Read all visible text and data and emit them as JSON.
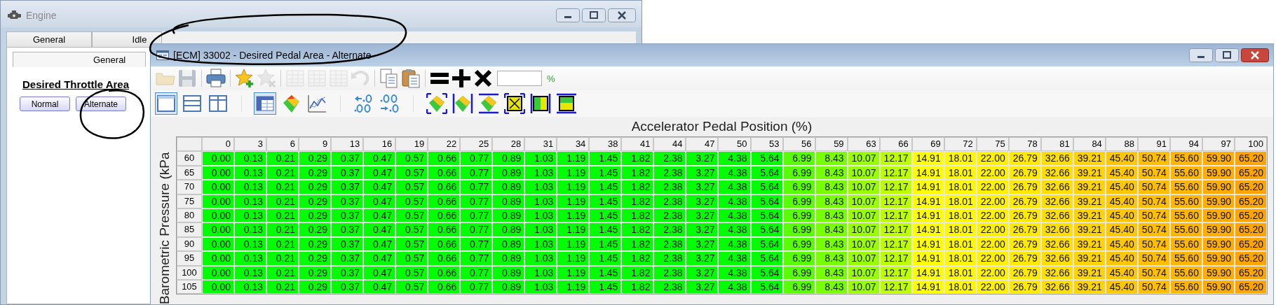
{
  "background_window": {
    "title": "Engine",
    "tabs": [
      {
        "label": "General",
        "selected": false
      },
      {
        "label": "Idle",
        "selected": false
      }
    ],
    "subtabs": [
      {
        "label": "General",
        "selected": true
      }
    ],
    "section_title": "Desired Throttle Area",
    "buttons": [
      {
        "label": "Normal"
      },
      {
        "label": "Alternate"
      }
    ]
  },
  "window": {
    "title": "[ECM] 33002 - Desired Pedal Area - Alternate",
    "toolbar_1": [
      {
        "kind": "folder",
        "disabled": true
      },
      {
        "kind": "save",
        "disabled": true
      },
      {
        "kind": "print",
        "disabled": false
      },
      {
        "kind": "star-add",
        "disabled": false
      },
      {
        "kind": "star-remove",
        "disabled": true
      },
      {
        "kind": "grid",
        "disabled": true
      },
      {
        "kind": "grid",
        "disabled": true
      },
      {
        "kind": "grid",
        "disabled": true
      },
      {
        "kind": "undo",
        "disabled": true
      },
      {
        "kind": "copy",
        "disabled": false
      },
      {
        "kind": "paste",
        "disabled": false
      },
      {
        "kind": "equals",
        "disabled": false
      },
      {
        "kind": "plus",
        "disabled": false
      },
      {
        "kind": "times",
        "disabled": false
      }
    ],
    "value_field": {
      "unit": "%"
    },
    "toolbar_2": [
      {
        "kind": "layout-single",
        "selected": true
      },
      {
        "kind": "layout-rows",
        "selected": false
      },
      {
        "kind": "layout-columns",
        "selected": false
      },
      {
        "kind": "table",
        "selected": true
      },
      {
        "kind": "surface",
        "selected": false
      },
      {
        "kind": "line-chart",
        "selected": false
      },
      {
        "kind": "decimal-less",
        "selected": false
      },
      {
        "kind": "decimal-more",
        "selected": false
      },
      {
        "kind": "sel-surface-all",
        "selected": false
      },
      {
        "kind": "sel-surface-cols",
        "selected": false
      },
      {
        "kind": "sel-surface-rows",
        "selected": false
      },
      {
        "kind": "sel-box-x",
        "selected": false
      },
      {
        "kind": "sel-box-cols",
        "selected": false
      },
      {
        "kind": "sel-box-rows",
        "selected": false
      }
    ],
    "table": {
      "x_title": "Accelerator Pedal Position (%)",
      "y_title": "Barometric Pressure (kPa",
      "columns": [
        "0",
        "3",
        "6",
        "9",
        "13",
        "16",
        "19",
        "22",
        "25",
        "28",
        "31",
        "34",
        "38",
        "41",
        "44",
        "47",
        "50",
        "53",
        "56",
        "59",
        "63",
        "66",
        "69",
        "72",
        "75",
        "78",
        "81",
        "84",
        "88",
        "91",
        "94",
        "97",
        "100"
      ],
      "rows": [
        {
          "label": "60",
          "cells": [
            "0.00",
            "0.13",
            "0.21",
            "0.29",
            "0.37",
            "0.47",
            "0.57",
            "0.66",
            "0.77",
            "0.89",
            "1.03",
            "1.19",
            "1.45",
            "1.82",
            "2.38",
            "3.27",
            "4.38",
            "5.64",
            "6.99",
            "8.43",
            "10.07",
            "12.17",
            "14.91",
            "18.01",
            "22.00",
            "26.79",
            "32.66",
            "39.21",
            "45.40",
            "50.74",
            "55.60",
            "59.90",
            "65.20"
          ]
        },
        {
          "label": "65",
          "cells": [
            "0.00",
            "0.13",
            "0.21",
            "0.29",
            "0.37",
            "0.47",
            "0.57",
            "0.66",
            "0.77",
            "0.89",
            "1.03",
            "1.19",
            "1.45",
            "1.82",
            "2.38",
            "3.27",
            "4.38",
            "5.64",
            "6.99",
            "8.43",
            "10.07",
            "12.17",
            "14.91",
            "18.01",
            "22.00",
            "26.79",
            "32.66",
            "39.21",
            "45.40",
            "50.74",
            "55.60",
            "59.90",
            "65.20"
          ]
        },
        {
          "label": "70",
          "cells": [
            "0.00",
            "0.13",
            "0.21",
            "0.29",
            "0.37",
            "0.47",
            "0.57",
            "0.66",
            "0.77",
            "0.89",
            "1.03",
            "1.19",
            "1.45",
            "1.82",
            "2.38",
            "3.27",
            "4.38",
            "5.64",
            "6.99",
            "8.43",
            "10.07",
            "12.17",
            "14.91",
            "18.01",
            "22.00",
            "26.79",
            "32.66",
            "39.21",
            "45.40",
            "50.74",
            "55.60",
            "59.90",
            "65.20"
          ]
        },
        {
          "label": "75",
          "cells": [
            "0.00",
            "0.13",
            "0.21",
            "0.29",
            "0.37",
            "0.47",
            "0.57",
            "0.66",
            "0.77",
            "0.89",
            "1.03",
            "1.19",
            "1.45",
            "1.82",
            "2.38",
            "3.27",
            "4.38",
            "5.64",
            "6.99",
            "8.43",
            "10.07",
            "12.17",
            "14.91",
            "18.01",
            "22.00",
            "26.79",
            "32.66",
            "39.21",
            "45.40",
            "50.74",
            "55.60",
            "59.90",
            "65.20"
          ]
        },
        {
          "label": "80",
          "cells": [
            "0.00",
            "0.13",
            "0.21",
            "0.29",
            "0.37",
            "0.47",
            "0.57",
            "0.66",
            "0.77",
            "0.89",
            "1.03",
            "1.19",
            "1.45",
            "1.82",
            "2.38",
            "3.27",
            "4.38",
            "5.64",
            "6.99",
            "8.43",
            "10.07",
            "12.17",
            "14.91",
            "18.01",
            "22.00",
            "26.79",
            "32.66",
            "39.21",
            "45.40",
            "50.74",
            "55.60",
            "59.90",
            "65.20"
          ]
        },
        {
          "label": "85",
          "cells": [
            "0.00",
            "0.13",
            "0.21",
            "0.29",
            "0.37",
            "0.47",
            "0.57",
            "0.66",
            "0.77",
            "0.89",
            "1.03",
            "1.19",
            "1.45",
            "1.82",
            "2.38",
            "3.27",
            "4.38",
            "5.64",
            "6.99",
            "8.43",
            "10.07",
            "12.17",
            "14.91",
            "18.01",
            "22.00",
            "26.79",
            "32.66",
            "39.21",
            "45.40",
            "50.74",
            "55.60",
            "59.90",
            "65.20"
          ]
        },
        {
          "label": "90",
          "cells": [
            "0.00",
            "0.13",
            "0.21",
            "0.29",
            "0.37",
            "0.47",
            "0.57",
            "0.66",
            "0.77",
            "0.89",
            "1.03",
            "1.19",
            "1.45",
            "1.82",
            "2.38",
            "3.27",
            "4.38",
            "5.64",
            "6.99",
            "8.43",
            "10.07",
            "12.17",
            "14.91",
            "18.01",
            "22.00",
            "26.79",
            "32.66",
            "39.21",
            "45.40",
            "50.74",
            "55.60",
            "59.90",
            "65.20"
          ]
        },
        {
          "label": "95",
          "cells": [
            "0.00",
            "0.13",
            "0.21",
            "0.29",
            "0.37",
            "0.47",
            "0.57",
            "0.66",
            "0.77",
            "0.89",
            "1.03",
            "1.19",
            "1.45",
            "1.82",
            "2.38",
            "3.27",
            "4.38",
            "5.64",
            "6.99",
            "8.43",
            "10.07",
            "12.17",
            "14.91",
            "18.01",
            "22.00",
            "26.79",
            "32.66",
            "39.21",
            "45.40",
            "50.74",
            "55.60",
            "59.90",
            "65.20"
          ]
        },
        {
          "label": "100",
          "cells": [
            "0.00",
            "0.13",
            "0.21",
            "0.29",
            "0.37",
            "0.47",
            "0.57",
            "0.66",
            "0.77",
            "0.89",
            "1.03",
            "1.19",
            "1.45",
            "1.82",
            "2.38",
            "3.27",
            "4.38",
            "5.64",
            "6.99",
            "8.43",
            "10.07",
            "12.17",
            "14.91",
            "18.01",
            "22.00",
            "26.79",
            "32.66",
            "39.21",
            "45.40",
            "50.74",
            "55.60",
            "59.90",
            "65.20"
          ]
        },
        {
          "label": "105",
          "cells": [
            "0.00",
            "0.13",
            "0.21",
            "0.29",
            "0.37",
            "0.47",
            "0.57",
            "0.66",
            "0.77",
            "0.89",
            "1.03",
            "1.19",
            "1.45",
            "1.82",
            "2.38",
            "3.27",
            "4.38",
            "5.64",
            "6.99",
            "8.43",
            "10.07",
            "12.17",
            "14.91",
            "18.01",
            "22.00",
            "26.79",
            "32.66",
            "39.21",
            "45.40",
            "50.74",
            "55.60",
            "59.90",
            "65.20"
          ]
        }
      ]
    }
  }
}
